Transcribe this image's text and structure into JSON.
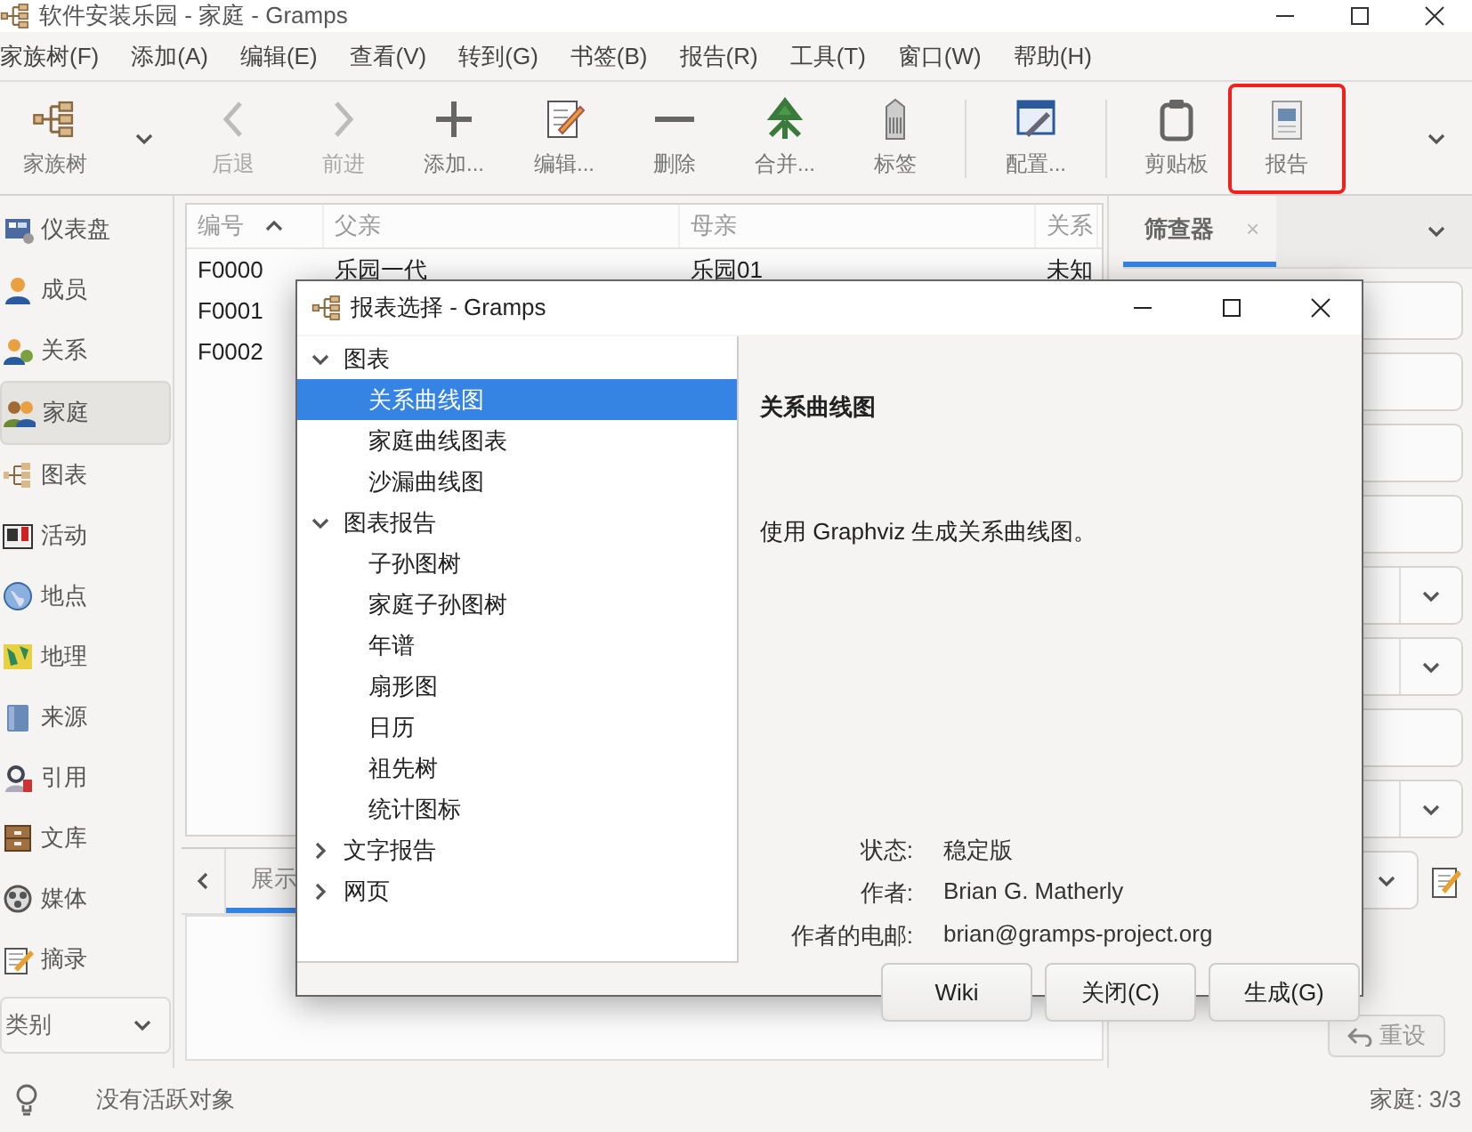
{
  "window": {
    "title": "软件安装乐园 - 家庭 - Gramps"
  },
  "menu": [
    "家族树(F)",
    "添加(A)",
    "编辑(E)",
    "查看(V)",
    "转到(G)",
    "书签(B)",
    "报告(R)",
    "工具(T)",
    "窗口(W)",
    "帮助(H)"
  ],
  "toolbar": [
    {
      "kind": "button",
      "label": "家族树",
      "disabled": false,
      "highlighted": false
    },
    {
      "kind": "dropdown"
    },
    {
      "kind": "button",
      "label": "后退",
      "disabled": true,
      "highlighted": false
    },
    {
      "kind": "button",
      "label": "前进",
      "disabled": true,
      "highlighted": false
    },
    {
      "kind": "button",
      "label": "添加...",
      "disabled": false,
      "highlighted": false
    },
    {
      "kind": "button",
      "label": "编辑...",
      "disabled": false,
      "highlighted": false
    },
    {
      "kind": "button",
      "label": "删除",
      "disabled": false,
      "highlighted": false
    },
    {
      "kind": "button",
      "label": "合并...",
      "disabled": false,
      "highlighted": false
    },
    {
      "kind": "button",
      "label": "标签",
      "disabled": false,
      "highlighted": false
    },
    {
      "kind": "separator"
    },
    {
      "kind": "button",
      "label": "配置...",
      "disabled": false,
      "highlighted": false
    },
    {
      "kind": "separator"
    },
    {
      "kind": "button",
      "label": "剪贴板",
      "disabled": false,
      "highlighted": false
    },
    {
      "kind": "button",
      "label": "报告",
      "disabled": false,
      "highlighted": true
    },
    {
      "kind": "overflow"
    }
  ],
  "sidebar": {
    "items": [
      {
        "label": "仪表盘",
        "selected": false
      },
      {
        "label": "成员",
        "selected": false
      },
      {
        "label": "关系",
        "selected": false
      },
      {
        "label": "家庭",
        "selected": true
      },
      {
        "label": "图表",
        "selected": false
      },
      {
        "label": "活动",
        "selected": false
      },
      {
        "label": "地点",
        "selected": false
      },
      {
        "label": "地理",
        "selected": false
      },
      {
        "label": "来源",
        "selected": false
      },
      {
        "label": "引用",
        "selected": false
      },
      {
        "label": "文库",
        "selected": false
      },
      {
        "label": "媒体",
        "selected": false
      },
      {
        "label": "摘录",
        "selected": false
      }
    ],
    "category": "类别"
  },
  "table": {
    "columns": [
      "编号",
      "父亲",
      "母亲",
      "关系"
    ],
    "rows": [
      [
        "F0000",
        "乐园一代",
        "乐园01",
        "未知"
      ],
      [
        "F0001"
      ],
      [
        "F0002"
      ]
    ]
  },
  "bottom_tabs": [
    {
      "label": "展示",
      "selected": true
    }
  ],
  "filter": {
    "tab": "筛查器",
    "tab_close": "×",
    "fields": [
      {
        "kind": "text"
      },
      {
        "kind": "text"
      },
      {
        "kind": "text"
      },
      {
        "kind": "text"
      },
      {
        "kind": "combo"
      },
      {
        "kind": "combo"
      },
      {
        "kind": "text"
      },
      {
        "kind": "combo"
      },
      {
        "kind": "combo_edit"
      }
    ],
    "reset": "重设"
  },
  "status_bar": {
    "message": "没有活跃对象",
    "count": "家庭: 3/3"
  },
  "dialog": {
    "title": "报表选择 - Gramps",
    "tree": [
      {
        "label": "图表",
        "expanded": true,
        "children": [
          {
            "label": "关系曲线图",
            "selected": true
          },
          {
            "label": "家庭曲线图表",
            "selected": false
          },
          {
            "label": "沙漏曲线图",
            "selected": false
          }
        ]
      },
      {
        "label": "图表报告",
        "expanded": true,
        "children": [
          {
            "label": "子孙图树",
            "selected": false
          },
          {
            "label": "家庭子孙图树",
            "selected": false
          },
          {
            "label": "年谱",
            "selected": false
          },
          {
            "label": "扇形图",
            "selected": false
          },
          {
            "label": "日历",
            "selected": false
          },
          {
            "label": "祖先树",
            "selected": false
          },
          {
            "label": "统计图标",
            "selected": false
          }
        ]
      },
      {
        "label": "文字报告",
        "expanded": false
      },
      {
        "label": "网页",
        "expanded": false
      }
    ],
    "heading": "关系曲线图",
    "description": "使用 Graphviz 生成关系曲线图。",
    "info": [
      {
        "label": "状态:",
        "value": "稳定版"
      },
      {
        "label": "作者:",
        "value": "Brian G. Matherly"
      },
      {
        "label": "作者的电邮:",
        "value": "brian@gramps-project.org"
      }
    ],
    "buttons": [
      "Wiki",
      "关闭(C)",
      "生成(G)"
    ]
  }
}
